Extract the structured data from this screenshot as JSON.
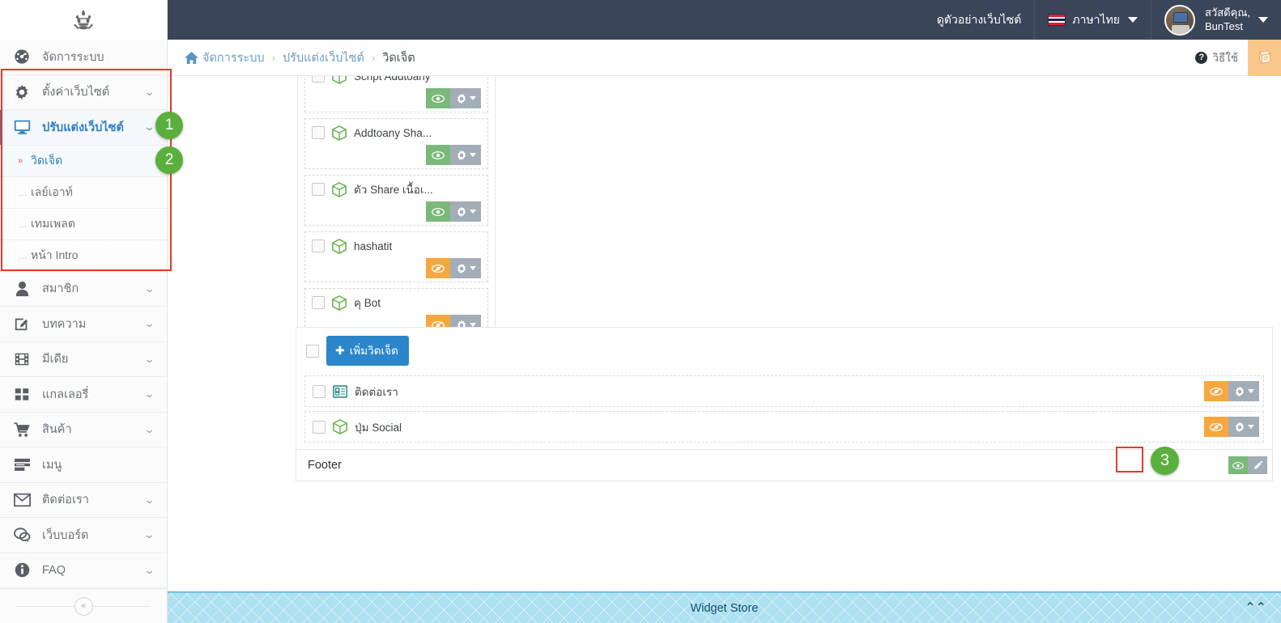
{
  "header": {
    "logo_icon": "crown-emblem-logo",
    "preview_site": "ดูตัวอย่างเว็บไซต์",
    "language": "ภาษาไทย",
    "language_flag": "thailand-flag-icon",
    "greeting_line1": "สวัสดีคุณ,",
    "greeting_line2": "BunTest",
    "avatar_icon": "user-avatar"
  },
  "sidebar": {
    "items": [
      {
        "label": "จัดการระบบ",
        "icon": "dashboard-icon",
        "chevron": false,
        "active": false
      },
      {
        "label": "ตั้งค่าเว็บไซต์",
        "icon": "gear-icon",
        "chevron": true,
        "active": false
      },
      {
        "label": "ปรับแต่งเว็บไซต์",
        "icon": "monitor-icon",
        "chevron": true,
        "active": true
      },
      {
        "label": "สมาชิก",
        "icon": "user-icon",
        "chevron": true,
        "active": false
      },
      {
        "label": "บทความ",
        "icon": "edit-square-icon",
        "chevron": true,
        "active": false
      },
      {
        "label": "มีเดีย",
        "icon": "film-icon",
        "chevron": true,
        "active": false
      },
      {
        "label": "แกลเลอรี่",
        "icon": "grid-icon",
        "chevron": true,
        "active": false
      },
      {
        "label": "สินค้า",
        "icon": "cart-icon",
        "chevron": true,
        "active": false
      },
      {
        "label": "เมนู",
        "icon": "list-icon",
        "chevron": false,
        "active": false
      },
      {
        "label": "ติดต่อเรา",
        "icon": "envelope-icon",
        "chevron": true,
        "active": false
      },
      {
        "label": "เว็บบอร์ด",
        "icon": "comments-icon",
        "chevron": true,
        "active": false
      },
      {
        "label": "FAQ",
        "icon": "info-circle-icon",
        "chevron": true,
        "active": false
      }
    ],
    "submenu": [
      {
        "label": "วิดเจ็ต",
        "current": true
      },
      {
        "label": "เลย์เอาท์",
        "current": false
      },
      {
        "label": "เทมเพลต",
        "current": false
      },
      {
        "label": "หน้า Intro",
        "current": false
      }
    ],
    "collapse_icon": "double-chevron-left-icon"
  },
  "breadcrumb": {
    "home_icon": "home-icon",
    "items": [
      "จัดการระบบ",
      "ปรับแต่งเว็บไซต์",
      "วิดเจ็ต"
    ],
    "separator": "›",
    "howto_label": "วิธีใช้",
    "howto_icon": "question-mark-icon",
    "manual_icon": "book-icon"
  },
  "widget_panel": {
    "rows": [
      {
        "name": "Script Addtoany",
        "icon": "green-cube-icon",
        "visible": true,
        "clipped": true
      },
      {
        "name": "Addtoany Sha...",
        "icon": "green-cube-icon",
        "visible": true,
        "clipped": false
      },
      {
        "name": "ตัว Share เนื้อเ...",
        "icon": "green-cube-icon",
        "visible": true,
        "clipped": false
      },
      {
        "name": "hashatit",
        "icon": "green-cube-icon",
        "visible": false,
        "clipped": false
      },
      {
        "name": "คุ Bot",
        "icon": "green-cube-icon",
        "visible": false,
        "clipped": false
      }
    ],
    "eye_icon": "eye-icon",
    "eye_slash_icon": "eye-slash-icon",
    "gear_icon": "gear-icon",
    "caret_icon": "caret-down-icon",
    "checkbox_icon": "checkbox-unchecked"
  },
  "widget_area": {
    "add_button_label": "เพิ่มวิดเจ็ต",
    "add_button_plus": "✚",
    "rows": [
      {
        "name": "ติดต่อเรา",
        "icon": "contact-card-icon",
        "visible": false
      },
      {
        "name": "ปุ่ม Social",
        "icon": "green-cube-icon",
        "visible": false
      }
    ]
  },
  "footer_block": {
    "label": "Footer",
    "eye_icon": "eye-icon",
    "edit_icon": "pencil-icon"
  },
  "widget_store": {
    "label": "Widget Store",
    "expand_icon": "double-chevron-up-icon"
  },
  "annotations": [
    {
      "number": "1"
    },
    {
      "number": "2"
    },
    {
      "number": "3"
    }
  ],
  "colors": {
    "header_bg": "#3b4559",
    "accent_blue": "#2f7fc1",
    "add_button": "#2b86cc",
    "badge_green": "#5aaf3d",
    "highlight_red": "#e8382c",
    "eye_on_green": "#7ab97a",
    "eye_off_orange": "#f5a83f",
    "gear_grey": "#a2adb8",
    "store_bg": "#aee1ef",
    "manual_orange": "#f8c789"
  }
}
